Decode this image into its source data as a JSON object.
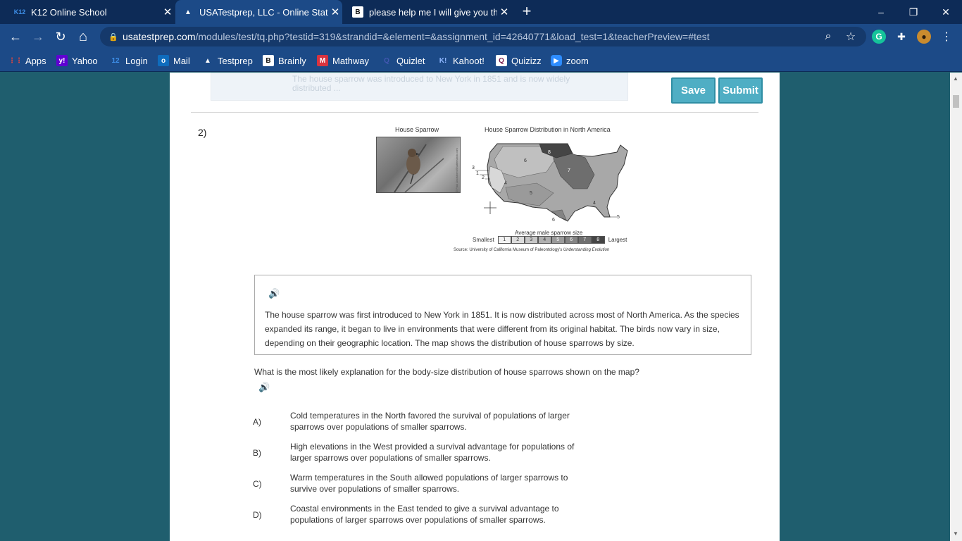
{
  "tabs": [
    {
      "label": "K12 Online School",
      "fav": "K12",
      "fav_color": "#3e8fe8"
    },
    {
      "label": "USATestprep, LLC - Online State-",
      "fav": "▲",
      "fav_color": "#ffffff"
    },
    {
      "label": "please help me I will give you the",
      "fav": "B",
      "fav_color": "#111111"
    }
  ],
  "new_tab_glyph": "+",
  "close_glyph": "✕",
  "window_controls": {
    "minimize": "–",
    "restore": "❐",
    "close": "✕"
  },
  "nav": {
    "back": "←",
    "forward": "→",
    "reload": "↻",
    "home": "⌂"
  },
  "address": {
    "host": "usatestprep.com",
    "path": "/modules/test/tq.php?testid=319&strandid=&element=&assignment_id=42640771&load_test=1&teacherPreview=#test"
  },
  "extensions": {
    "zoom_icon": "⌕",
    "star_icon": "☆",
    "grammarly": "G",
    "puzzle": "✚",
    "profile": "●",
    "menu": "⋮"
  },
  "bookmarks": [
    {
      "label": "Apps",
      "icon": "apps-grid-icon",
      "glyph": "⋮⋮",
      "color": "#e8453c"
    },
    {
      "label": "Yahoo",
      "icon": "yahoo-icon",
      "glyph": "y!",
      "color": "#6001d2"
    },
    {
      "label": "Login",
      "icon": "k12-icon",
      "glyph": "12",
      "color": "#3e8fe8"
    },
    {
      "label": "Mail",
      "icon": "outlook-icon",
      "glyph": "o",
      "color": "#0f6cbd"
    },
    {
      "label": "Testprep",
      "icon": "testprep-icon",
      "glyph": "▲",
      "color": "#ffffff"
    },
    {
      "label": "Brainly",
      "icon": "brainly-icon",
      "glyph": "B",
      "color": "#111111"
    },
    {
      "label": "Mathway",
      "icon": "mathway-icon",
      "glyph": "M",
      "color": "#d8333f"
    },
    {
      "label": "Quizlet",
      "icon": "quizlet-icon",
      "glyph": "Q",
      "color": "#4257b2"
    },
    {
      "label": "Kahoot!",
      "icon": "kahoot-icon",
      "glyph": "K!",
      "color": "#46178f"
    },
    {
      "label": "Quizizz",
      "icon": "quizizz-icon",
      "glyph": "Q",
      "color": "#7a1f4f"
    },
    {
      "label": "zoom",
      "icon": "zoom-icon",
      "glyph": "▶",
      "color": "#2d8cff"
    }
  ],
  "top_faded_text": "The house sparrow was introduced to New York in 1851 and is now widely distributed ...",
  "buttons": {
    "save": "Save",
    "submit": "Submit"
  },
  "question_number": "2)",
  "figure": {
    "photo_caption": "House Sparrow",
    "map_caption": "House Sparrow Distribution in North America",
    "legend_title": "Average male sparrow size",
    "legend_smallest": "Smallest",
    "legend_largest": "Largest",
    "legend_values": [
      "1",
      "2",
      "3",
      "4",
      "5",
      "6",
      "7",
      "8"
    ],
    "legend_colors": [
      "#f2f2f2",
      "#dcdcdc",
      "#c6c6c6",
      "#b0b0b0",
      "#9a9a9a",
      "#848484",
      "#6e6e6e",
      "#454545"
    ],
    "source_prefix": "Source: University of California Museum of Paleontology's ",
    "source_italic": "Understanding Evolution",
    "map_region_labels": [
      "8",
      "6",
      "7",
      "3",
      "1",
      "2",
      "4",
      "5",
      "4",
      "5",
      "6"
    ],
    "photo_credit": "© Paul Lindstrom/Shutterstock.com"
  },
  "passage": "The house sparrow was first introduced to New York in 1851. It is now distributed across most of North America. As the species expanded its range, it began to live in environments that were different from its original habitat. The birds now vary in size, depending on their geographic location. The map shows the distribution of house sparrows by size.",
  "question": "What is the most likely explanation for the body-size distribution of house sparrows shown on the map?",
  "choices": [
    {
      "label": "A)",
      "text": "Cold temperatures in the North favored the survival of populations of larger sparrows over populations of smaller sparrows."
    },
    {
      "label": "B)",
      "text": "High elevations in the West provided a survival advantage for populations of larger sparrows over populations of smaller sparrows."
    },
    {
      "label": "C)",
      "text": "Warm temperatures in the South allowed populations of larger sparrows to survive over populations of smaller sparrows."
    },
    {
      "label": "D)",
      "text": "Coastal environments in the East tended to give a survival advantage to populations of larger sparrows over populations of smaller sparrows."
    }
  ],
  "speaker_glyph": "🔊"
}
